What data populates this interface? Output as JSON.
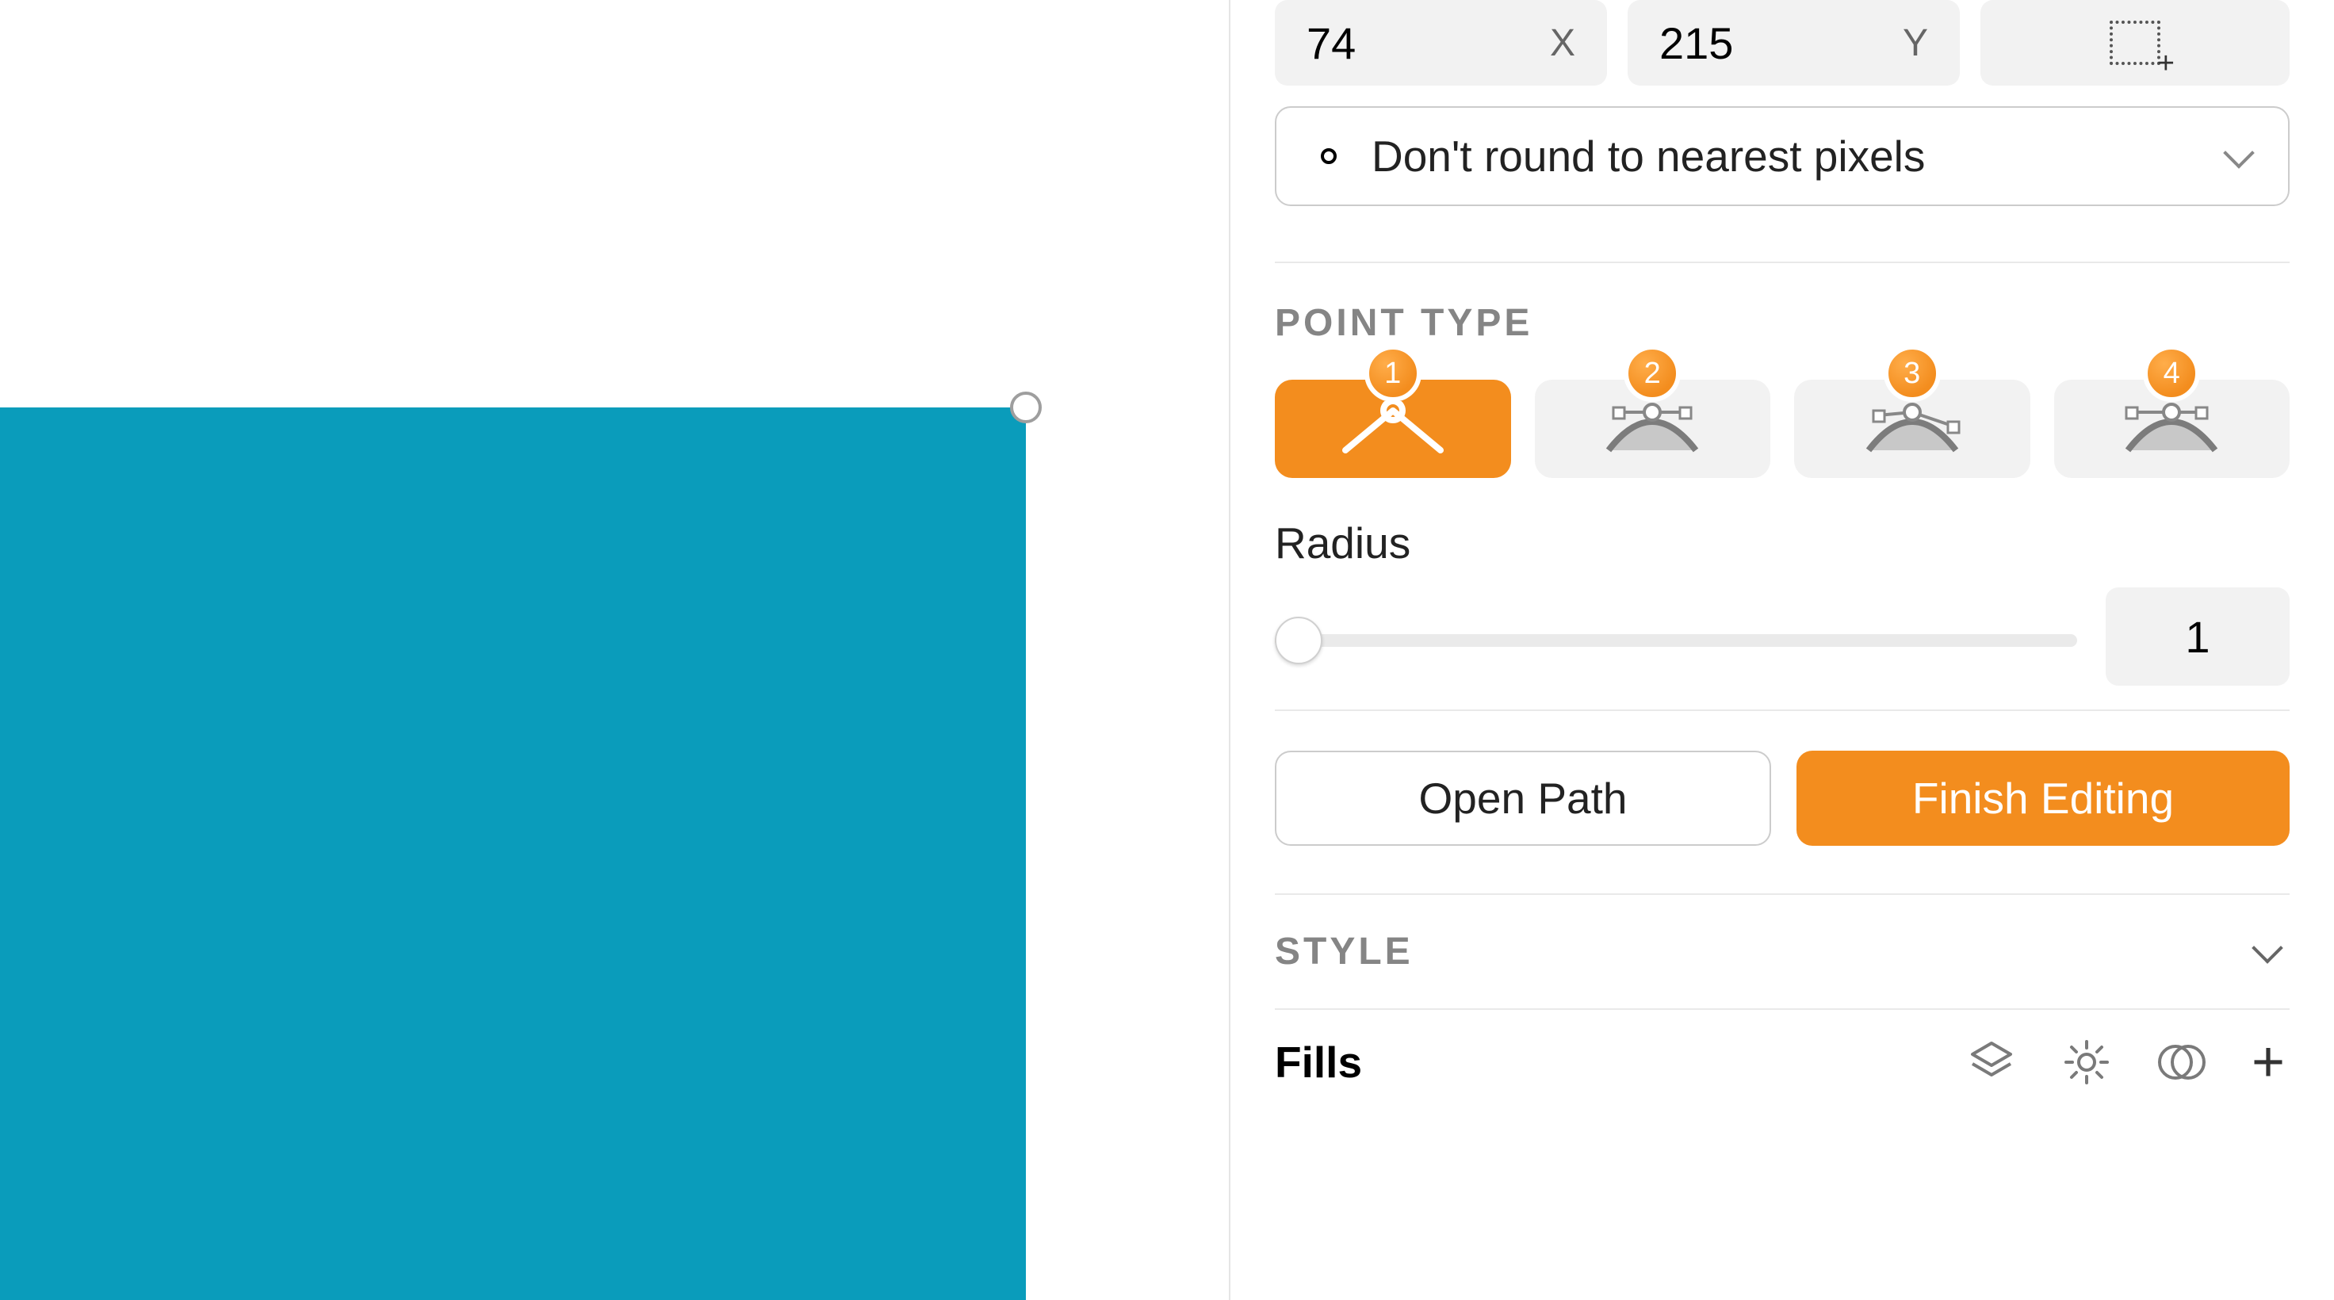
{
  "coords": {
    "x_value": "74",
    "x_label": "X",
    "y_value": "215",
    "y_label": "Y"
  },
  "rounding": {
    "selected": "Don't round to nearest pixels"
  },
  "point_type": {
    "heading": "POINT TYPE",
    "badges": [
      "1",
      "2",
      "3",
      "4"
    ]
  },
  "radius": {
    "label": "Radius",
    "value": "1"
  },
  "buttons": {
    "open_path": "Open Path",
    "finish_editing": "Finish Editing"
  },
  "style": {
    "heading": "STYLE",
    "fills": "Fills"
  },
  "colors": {
    "shape_fill": "#0a9cbb",
    "accent": "#f38d1e"
  }
}
